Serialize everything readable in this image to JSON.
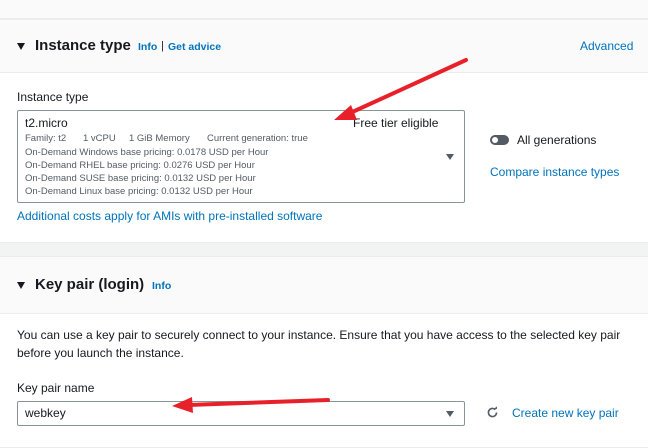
{
  "instance_type_section": {
    "title": "Instance type",
    "info_link": "Info",
    "separator": "|",
    "advice_link": "Get advice",
    "advanced_link": "Advanced",
    "field_label": "Instance type",
    "selected": {
      "name": "t2.micro",
      "badge": "Free tier eligible",
      "family": "Family: t2",
      "vcpu": "1 vCPU",
      "memory": "1 GiB Memory",
      "generation": "Current generation: true",
      "pricing": [
        "On-Demand Windows base pricing: 0.0178 USD per Hour",
        "On-Demand RHEL base pricing: 0.0276 USD per Hour",
        "On-Demand SUSE base pricing: 0.0132 USD per Hour",
        "On-Demand Linux base pricing: 0.0132 USD per Hour"
      ]
    },
    "all_generations_label": "All generations",
    "compare_link": "Compare instance types",
    "additional_costs_link": "Additional costs apply for AMIs with pre-installed software"
  },
  "key_pair_section": {
    "title": "Key pair (login)",
    "info_link": "Info",
    "description_line1": "You can use a key pair to securely connect to your instance. Ensure that you have access to the selected key pair",
    "description_line2": "before you launch the instance.",
    "field_label": "Key pair name",
    "selected_value": "webkey",
    "create_link": "Create new key pair"
  },
  "colors": {
    "link": "#0073bb",
    "annotation_arrow": "#e8202a",
    "background": "#f2f3f3"
  }
}
